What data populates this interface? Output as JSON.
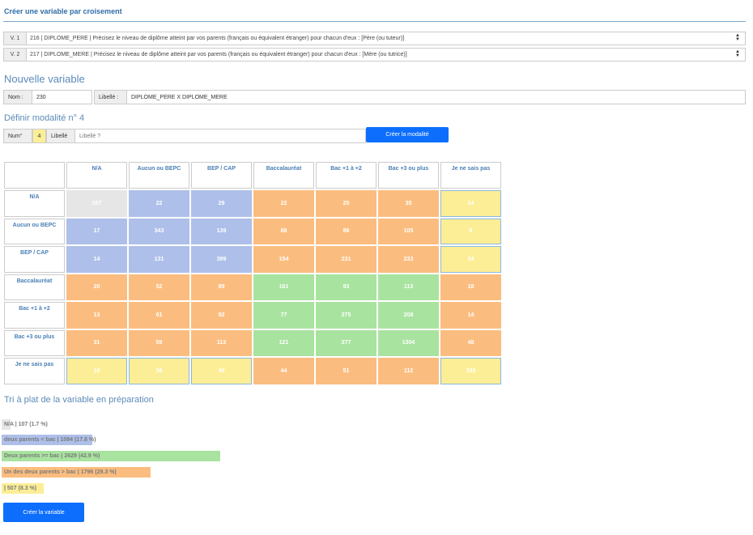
{
  "title": "Créer une variable par croisement",
  "variables": [
    {
      "label": "V. 1",
      "value": "216 | DIPLOME_PERE | Précisez le niveau de diplôme atteint par vos parents (français ou équivalent étranger) pour chacun d'eux : [Père (ou tuteur)]"
    },
    {
      "label": "V. 2",
      "value": "217 | DIPLOME_MERE | Précisez le niveau de diplôme atteint par vos parents (français ou équivalent étranger) pour chacun d'eux : [Mère (ou tutrice)]"
    }
  ],
  "new_variable": {
    "heading": "Nouvelle variable",
    "nom_label": "Nom :",
    "nom_value": "230",
    "libelle_label": "Libellé :",
    "libelle_value": "DIPLOME_PERE X DIPLOME_MERE"
  },
  "modalite": {
    "heading": "Définir modalité n° 4",
    "num_label": "Num°",
    "num_value": "4",
    "libelle_label": "Libellé",
    "libelle_placeholder": "Libellé ?",
    "create_button": "Créer la modalité"
  },
  "grid": {
    "columns": [
      "N/A",
      "Aucun ou BEPC",
      "BEP / CAP",
      "Baccalauréat",
      "Bac +1 à +2",
      "Bac +3 ou plus",
      "Je ne sais pas"
    ],
    "rows": [
      {
        "label": "N/A",
        "values": [
          "107",
          "22",
          "29",
          "22",
          "25",
          "35",
          "14"
        ],
        "colors": [
          "na",
          "blue",
          "blue",
          "orange",
          "orange",
          "orange",
          "yellow"
        ]
      },
      {
        "label": "Aucun ou BEPC",
        "values": [
          "17",
          "343",
          "139",
          "88",
          "86",
          "105",
          "9"
        ],
        "colors": [
          "blue",
          "blue",
          "blue",
          "orange",
          "orange",
          "orange",
          "yellow"
        ]
      },
      {
        "label": "BEP / CAP",
        "values": [
          "14",
          "131",
          "399",
          "154",
          "231",
          "233",
          "34"
        ],
        "colors": [
          "blue",
          "blue",
          "blue",
          "orange",
          "orange",
          "orange",
          "yellow"
        ]
      },
      {
        "label": "Baccalauréat",
        "values": [
          "20",
          "52",
          "89",
          "161",
          "93",
          "113",
          "18"
        ],
        "colors": [
          "orange",
          "orange",
          "orange",
          "green",
          "green",
          "green",
          "orange"
        ]
      },
      {
        "label": "Bac +1 à +2",
        "values": [
          "13",
          "61",
          "92",
          "77",
          "275",
          "208",
          "14"
        ],
        "colors": [
          "orange",
          "orange",
          "orange",
          "green",
          "green",
          "green",
          "orange"
        ]
      },
      {
        "label": "Bac +3 ou plus",
        "values": [
          "31",
          "59",
          "113",
          "121",
          "277",
          "1304",
          "48"
        ],
        "colors": [
          "orange",
          "orange",
          "orange",
          "green",
          "green",
          "green",
          "orange"
        ]
      },
      {
        "label": "Je ne sais pas",
        "values": [
          "10",
          "36",
          "40",
          "44",
          "51",
          "112",
          "333"
        ],
        "colors": [
          "yellow",
          "yellow",
          "yellow",
          "orange",
          "orange",
          "orange",
          "yellow"
        ]
      }
    ]
  },
  "tri": {
    "heading": "Tri à plat de la variable en préparation",
    "bars": [
      {
        "text": "N/A | 107 (1.7 %)",
        "color": "#e6e6e6",
        "percent": 1.7
      },
      {
        "text": "deux parents < bac | 1094 (17.8 %)",
        "color": "#aebfe9",
        "percent": 17.8
      },
      {
        "text": "Deux parents >= bac | 2629 (42.9 %)",
        "color": "#a9e3a0",
        "percent": 42.9
      },
      {
        "text": "Un des deux parents > bac | 1796 (29.3 %)",
        "color": "#fbbd7f",
        "percent": 29.3
      },
      {
        "text": "| 507 (8.3 %)",
        "color": "#fcee96",
        "percent": 8.3
      }
    ]
  },
  "create_variable_button": "Créer la variable"
}
